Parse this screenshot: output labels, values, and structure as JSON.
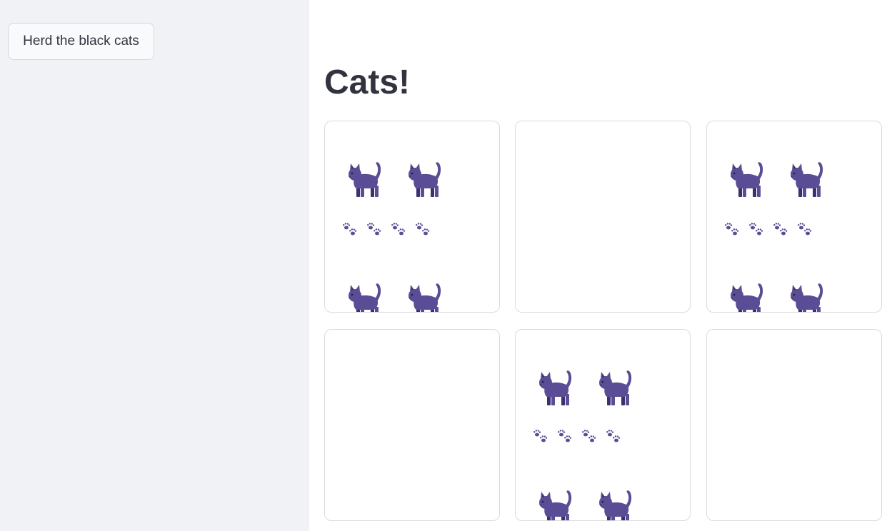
{
  "sidebar": {
    "button_label": "Herd the black cats"
  },
  "main": {
    "title": "Cats!"
  },
  "grid": {
    "cards": [
      {
        "has_cats": true
      },
      {
        "has_cats": false
      },
      {
        "has_cats": true
      },
      {
        "has_cats": false
      },
      {
        "has_cats": true
      },
      {
        "has_cats": false
      }
    ]
  },
  "colors": {
    "sidebar_bg": "#f0f2f6",
    "text": "#31333f",
    "cat_body": "#5b4d95",
    "cat_legs": "#3f2f6e",
    "card_border": "#d9dbe1"
  },
  "icons": {
    "cat": "cat-icon",
    "paw": "paw-prints-icon"
  }
}
